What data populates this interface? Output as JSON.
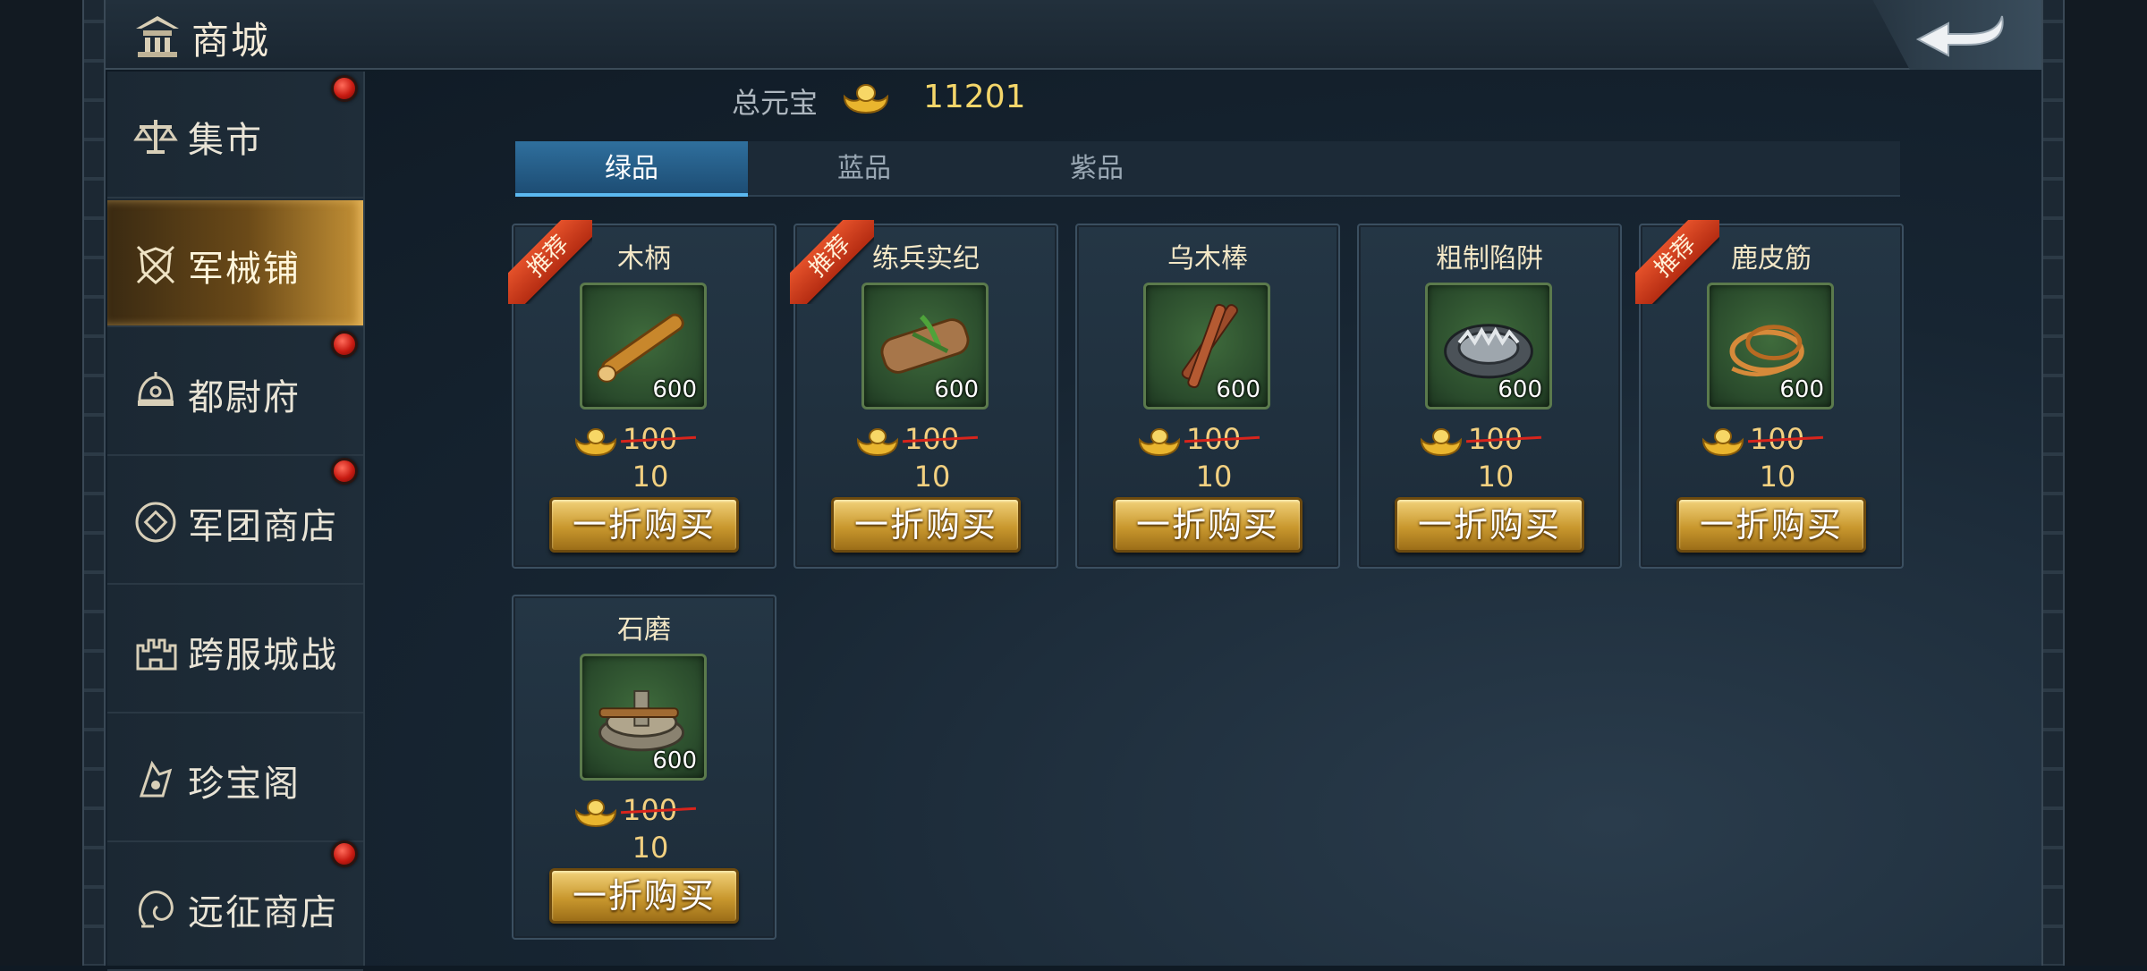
{
  "header": {
    "title": "商城",
    "icon": "pavilion-icon",
    "back_icon": "return-arrow-icon"
  },
  "sidebar": {
    "items": [
      {
        "label": "集市",
        "icon": "scale-icon",
        "badge": true,
        "active": false
      },
      {
        "label": "军械铺",
        "icon": "shield-swords-icon",
        "badge": false,
        "active": true
      },
      {
        "label": "都尉府",
        "icon": "helmet-icon",
        "badge": true,
        "active": false
      },
      {
        "label": "军团商店",
        "icon": "coin-emblem-icon",
        "badge": true,
        "active": false
      },
      {
        "label": "跨服城战",
        "icon": "castle-icon",
        "badge": false,
        "active": false
      },
      {
        "label": "珍宝阁",
        "icon": "treasure-icon",
        "badge": false,
        "active": false
      },
      {
        "label": "远征商店",
        "icon": "expedition-icon",
        "badge": true,
        "active": false
      }
    ]
  },
  "currency": {
    "label": "总元宝",
    "value": "11201",
    "icon": "gold-ingot-icon"
  },
  "tabs": [
    {
      "label": "绿品",
      "active": true
    },
    {
      "label": "蓝品",
      "active": false
    },
    {
      "label": "紫品",
      "active": false
    }
  ],
  "products": [
    {
      "name": "木柄",
      "recommended": true,
      "ribbon": "推荐",
      "count": "600",
      "old_price": "100",
      "new_price": "10",
      "button": "一折购买",
      "icon": "wooden-handle-icon"
    },
    {
      "name": "练兵实纪",
      "recommended": true,
      "ribbon": "推荐",
      "count": "600",
      "old_price": "100",
      "new_price": "10",
      "button": "一折购买",
      "icon": "scroll-icon"
    },
    {
      "name": "乌木棒",
      "recommended": false,
      "ribbon": "",
      "count": "600",
      "old_price": "100",
      "new_price": "10",
      "button": "一折购买",
      "icon": "ebony-sticks-icon"
    },
    {
      "name": "粗制陷阱",
      "recommended": false,
      "ribbon": "",
      "count": "600",
      "old_price": "100",
      "new_price": "10",
      "button": "一折购买",
      "icon": "bear-trap-icon"
    },
    {
      "name": "鹿皮筋",
      "recommended": true,
      "ribbon": "推荐",
      "count": "600",
      "old_price": "100",
      "new_price": "10",
      "button": "一折购买",
      "icon": "sinew-rope-icon"
    },
    {
      "name": "石磨",
      "recommended": false,
      "ribbon": "",
      "count": "600",
      "old_price": "100",
      "new_price": "10",
      "button": "一折购买",
      "icon": "millstone-icon"
    }
  ],
  "colors": {
    "gold": "#f2d080",
    "tab_active": "#2f6f9d",
    "badge_red": "#c81b12",
    "ribbon": "#e4512a"
  }
}
